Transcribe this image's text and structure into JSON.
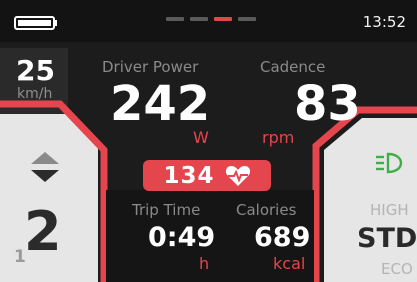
{
  "status_bar": {
    "battery_icon": "battery-icon",
    "page_dots": {
      "count": 4,
      "active_index": 2,
      "active_color": "#e5464e"
    },
    "time": "13:52"
  },
  "speed": {
    "value": "25",
    "unit": "km/h"
  },
  "driver_power": {
    "label": "Driver Power",
    "value": "242",
    "unit": "W"
  },
  "cadence": {
    "label": "Cadence",
    "value": "83",
    "unit": "rpm"
  },
  "heart_rate": {
    "value": "134",
    "icon": "heart-pulse-icon"
  },
  "trip_time": {
    "label": "Trip Time",
    "value": "0:49",
    "unit": "h"
  },
  "calories": {
    "label": "Calories",
    "value": "689",
    "unit": "kcal"
  },
  "gear": {
    "icon": "gear-up-down-icon",
    "previous": "1",
    "current": "2"
  },
  "assist_mode": {
    "icon": "headlight-icon",
    "options": [
      "HIGH",
      "STD",
      "ECO"
    ],
    "selected": "STD"
  },
  "colors": {
    "accent": "#e5464e",
    "panel_dark": "#1c1c1c",
    "panel_light": "#e8e8e8"
  }
}
